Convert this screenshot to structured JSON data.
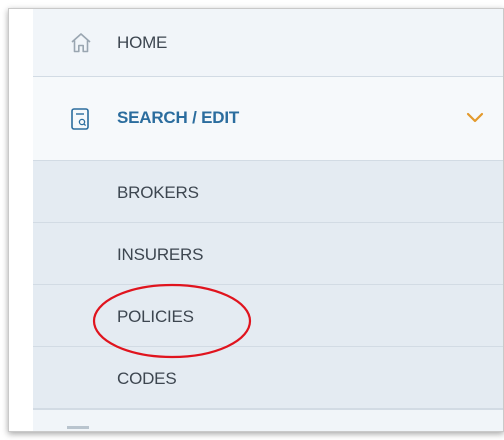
{
  "nav": {
    "home": {
      "label": "HOME",
      "icon": "home-icon"
    },
    "search_edit": {
      "label": "SEARCH / EDIT",
      "icon": "search-document-icon",
      "expanded": true,
      "chevron_icon": "chevron-down-icon"
    },
    "submenu": [
      {
        "label": "BROKERS"
      },
      {
        "label": "INSURERS"
      },
      {
        "label": "POLICIES",
        "highlighted": true
      },
      {
        "label": "CODES"
      }
    ]
  },
  "colors": {
    "sidebar_bg": "#e7eef5",
    "active_text": "#2b6d9e",
    "chevron": "#e39a2d",
    "highlight_ring": "#e0141e",
    "text": "#3d4650"
  }
}
